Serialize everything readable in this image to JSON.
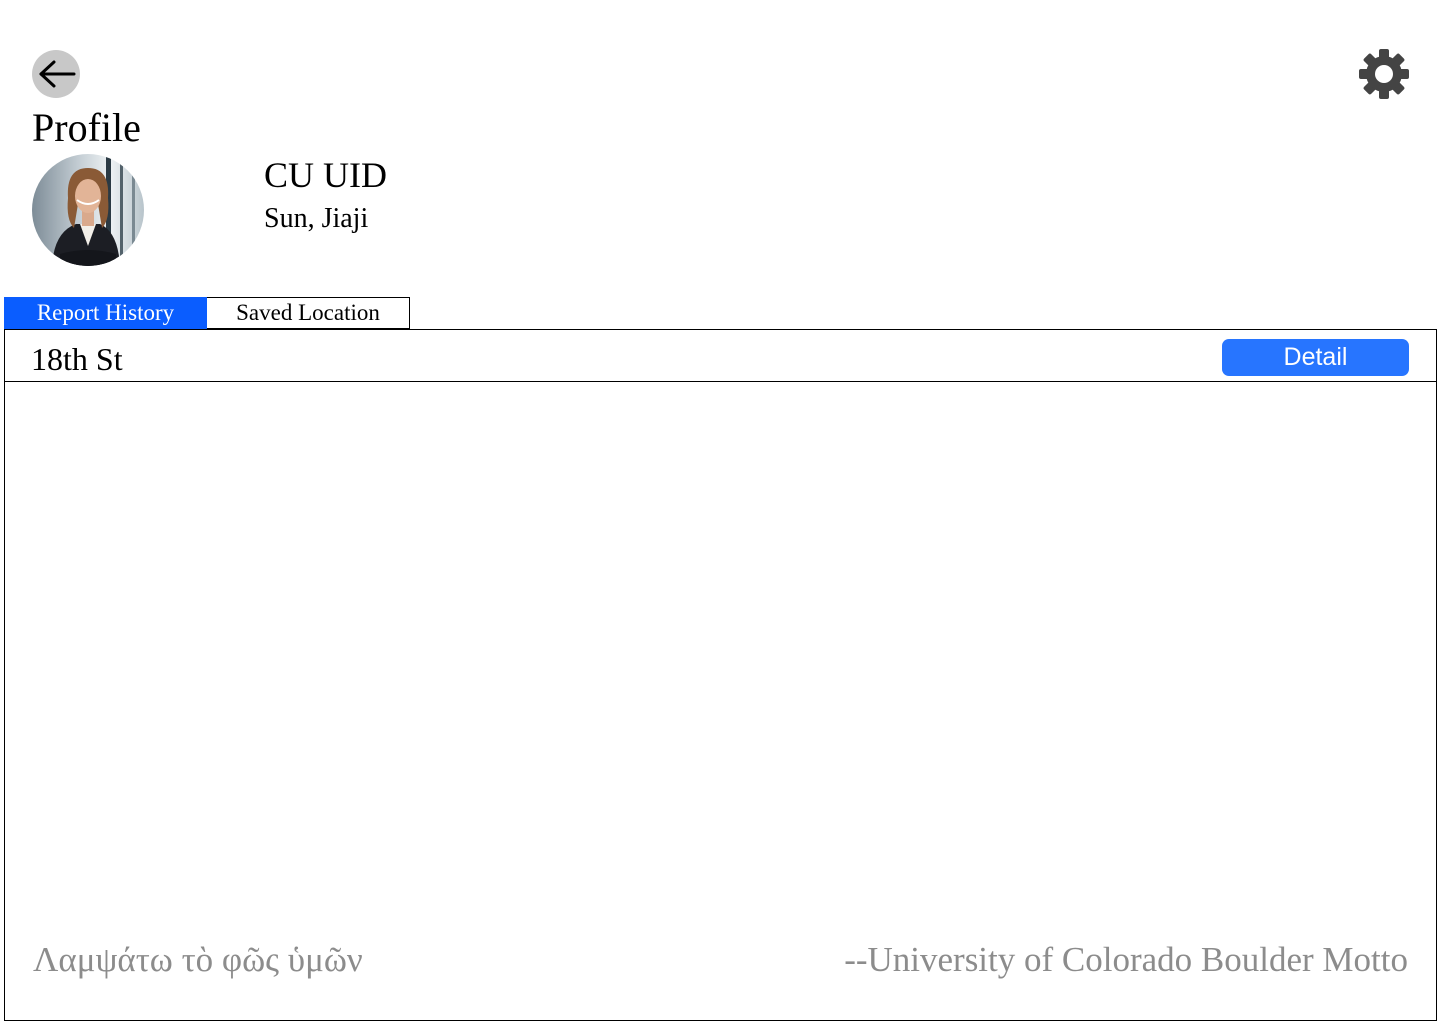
{
  "header": {
    "back_icon": "arrow-left-icon",
    "settings_icon": "gear-icon",
    "title": "Profile"
  },
  "profile": {
    "avatar": "profile-photo",
    "uid_label": "CU UID",
    "name": "Sun, Jiaji"
  },
  "tabs": [
    {
      "label": "Report History",
      "active": true,
      "color": "#0a5dff"
    },
    {
      "label": "Saved Location",
      "active": false
    }
  ],
  "report_history": {
    "items": [
      {
        "location": "18th St",
        "action_label": "Detail",
        "action_color": "#2775ff"
      }
    ]
  },
  "footer": {
    "motto": "Λαμψάτω τὸ φῶς ὑμῶν",
    "attribution": "--University of Colorado Boulder Motto",
    "text_color": "#8c8c8c"
  }
}
